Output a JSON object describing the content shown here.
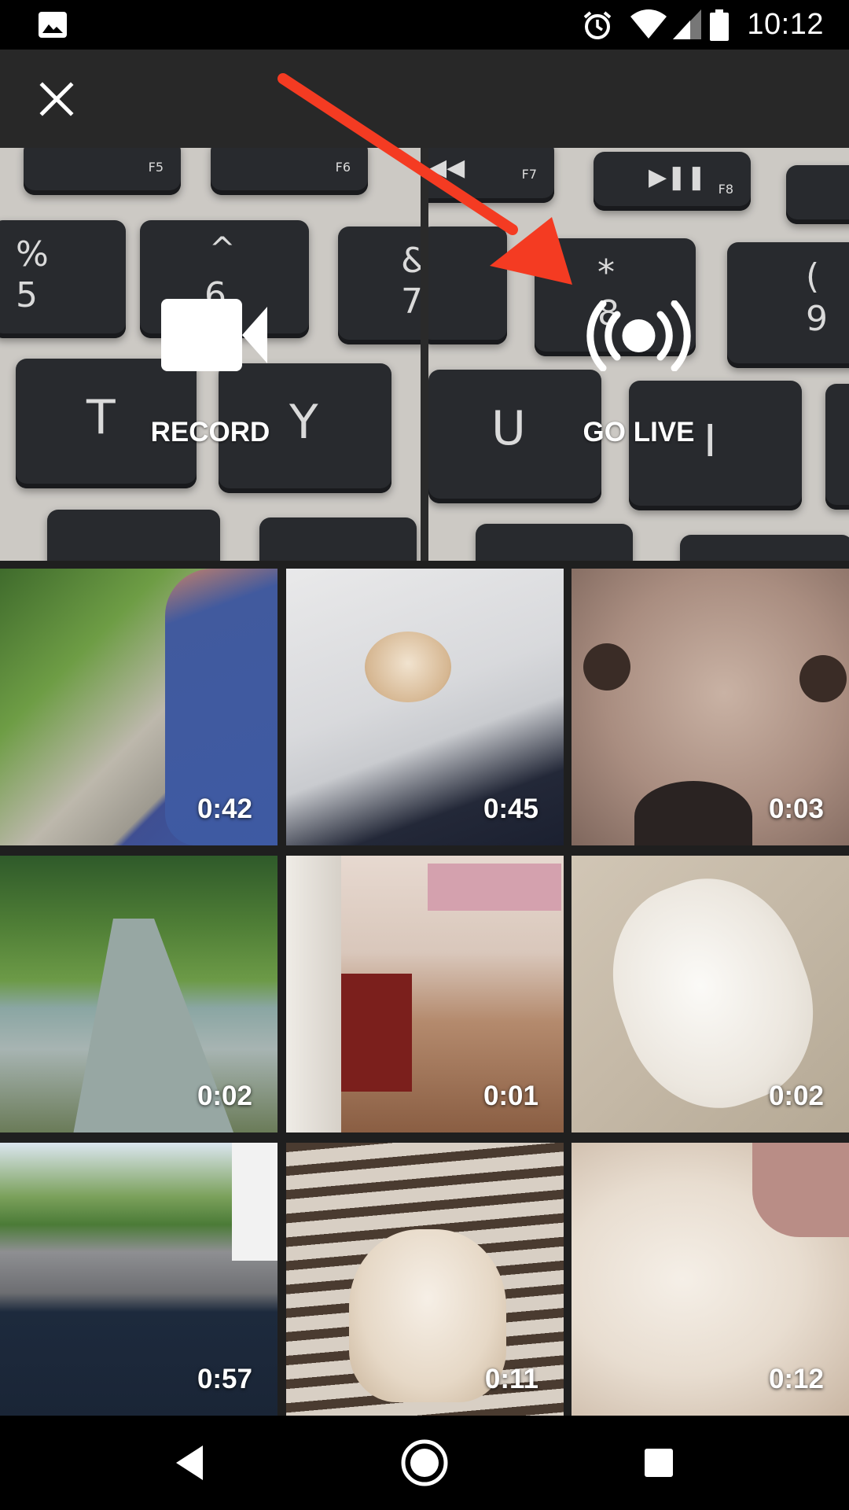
{
  "status_bar": {
    "time": "10:12",
    "icons": [
      "gallery-icon",
      "alarm-icon",
      "wifi-icon",
      "signal-icon",
      "battery-icon"
    ]
  },
  "toolbar": {
    "close_icon": "close-icon"
  },
  "camera": {
    "record": {
      "label": "RECORD",
      "icon": "video-camera-icon"
    },
    "go_live": {
      "label": "GO LIVE",
      "icon": "live-broadcast-icon"
    }
  },
  "videos": [
    {
      "duration": "0:42"
    },
    {
      "duration": "0:45"
    },
    {
      "duration": "0:03"
    },
    {
      "duration": "0:02"
    },
    {
      "duration": "0:01"
    },
    {
      "duration": "0:02"
    },
    {
      "duration": "0:57"
    },
    {
      "duration": "0:11"
    },
    {
      "duration": "0:12"
    }
  ],
  "nav_bar": {
    "icons": [
      "back-icon",
      "home-icon",
      "recents-icon"
    ]
  },
  "colors": {
    "annotation_arrow": "#f43b22",
    "toolbar_bg": "#282828",
    "status_bg": "#000000"
  }
}
